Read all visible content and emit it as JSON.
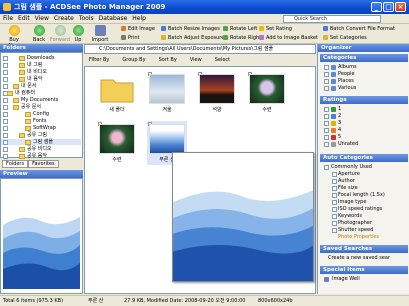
{
  "window": {
    "title": "그림 샘플 - ACDSee Photo Manager 2009"
  },
  "menu": [
    "File",
    "Edit",
    "View",
    "Create",
    "Tools",
    "Database",
    "Help"
  ],
  "quick_search": {
    "placeholder": "Quick Search"
  },
  "toolbar": {
    "buy_now": "Buy Now",
    "back": "Back",
    "forward": "Forward",
    "up": "Up",
    "import": "Import",
    "edit_image": "Edit Image",
    "print": "Print",
    "batch_resize": "Batch Resize Images",
    "batch_adjust": "Batch Adjust Exposure",
    "rotate_left": "Rotate Left",
    "rotate_right": "Rotate Right",
    "set_rating": "Set Rating",
    "add_to_basket": "Add to Image Basket",
    "batch_convert": "Batch Convert File Format",
    "set_categories": "Set Categories"
  },
  "path": "C:\\Documents and Settings\\All Users\\Documents\\My Pictures\\그림 샘플",
  "filter_bar": {
    "filter": "Filter By",
    "group": "Group By",
    "sort": "Sort By",
    "view": "View",
    "select": "Select"
  },
  "folders_panel": {
    "title": "Folders",
    "items": [
      "Downloads",
      "내 그림",
      "내 비디오",
      "내 음악",
      "내 문서",
      "내 컴퓨터",
      "My Documents",
      "공유 문서",
      "Config",
      "Fonts",
      "SoftWrap",
      "공유 그림",
      "그림 샘플",
      "공유 비디오",
      "공유 음악"
    ],
    "tabs": [
      "Folders",
      "Favorites"
    ]
  },
  "preview_panel": {
    "title": "Preview"
  },
  "files": [
    {
      "name": "새 폴더"
    },
    {
      "name": "겨울"
    },
    {
      "name": "석양"
    },
    {
      "name": "수련"
    },
    {
      "name": "수련"
    },
    {
      "name": "푸른 산"
    }
  ],
  "organizer": {
    "title": "Organizer",
    "categories_title": "Categories",
    "categories": [
      "Albums",
      "People",
      "Places",
      "Various"
    ],
    "ratings_title": "Ratings",
    "ratings": [
      "1",
      "2",
      "3",
      "4",
      "5",
      "Unrated"
    ],
    "auto_categories_title": "Auto Categories",
    "auto_categories": [
      "Commonly Used",
      "Aperture",
      "Author",
      "File size",
      "Focal length (1.5x)",
      "Image type",
      "ISO speed ratings",
      "Keywords",
      "Photographer",
      "Shutter speed",
      "Photo Properties"
    ],
    "saved_searches_title": "Saved Searches",
    "saved_searches": [
      "Create a new saved sear"
    ],
    "special_items_title": "Special Items",
    "special_items": [
      "Image Well"
    ]
  },
  "status": {
    "total": "Total 6 items  (975.3 KB)",
    "selected_name": "푸른 산",
    "file_info": "27.9 KB, Modified Date: 2008-09-20 오전 9:00:00",
    "dimensions": "800x600x24b"
  },
  "colors": {
    "titlebar": "#0a4bd1",
    "panel_header": "#3d6dc8",
    "accent_link": "#d47b00"
  }
}
